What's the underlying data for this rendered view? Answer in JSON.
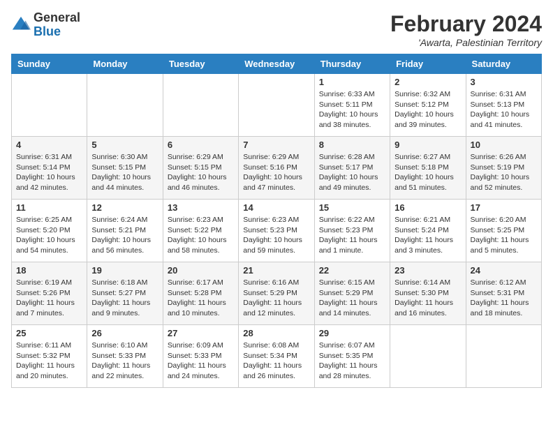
{
  "header": {
    "logo_general": "General",
    "logo_blue": "Blue",
    "month_title": "February 2024",
    "location": "'Awarta, Palestinian Territory"
  },
  "days_of_week": [
    "Sunday",
    "Monday",
    "Tuesday",
    "Wednesday",
    "Thursday",
    "Friday",
    "Saturday"
  ],
  "weeks": [
    [
      {
        "day": "",
        "detail": ""
      },
      {
        "day": "",
        "detail": ""
      },
      {
        "day": "",
        "detail": ""
      },
      {
        "day": "",
        "detail": ""
      },
      {
        "day": "1",
        "detail": "Sunrise: 6:33 AM\nSunset: 5:11 PM\nDaylight: 10 hours\nand 38 minutes."
      },
      {
        "day": "2",
        "detail": "Sunrise: 6:32 AM\nSunset: 5:12 PM\nDaylight: 10 hours\nand 39 minutes."
      },
      {
        "day": "3",
        "detail": "Sunrise: 6:31 AM\nSunset: 5:13 PM\nDaylight: 10 hours\nand 41 minutes."
      }
    ],
    [
      {
        "day": "4",
        "detail": "Sunrise: 6:31 AM\nSunset: 5:14 PM\nDaylight: 10 hours\nand 42 minutes."
      },
      {
        "day": "5",
        "detail": "Sunrise: 6:30 AM\nSunset: 5:15 PM\nDaylight: 10 hours\nand 44 minutes."
      },
      {
        "day": "6",
        "detail": "Sunrise: 6:29 AM\nSunset: 5:15 PM\nDaylight: 10 hours\nand 46 minutes."
      },
      {
        "day": "7",
        "detail": "Sunrise: 6:29 AM\nSunset: 5:16 PM\nDaylight: 10 hours\nand 47 minutes."
      },
      {
        "day": "8",
        "detail": "Sunrise: 6:28 AM\nSunset: 5:17 PM\nDaylight: 10 hours\nand 49 minutes."
      },
      {
        "day": "9",
        "detail": "Sunrise: 6:27 AM\nSunset: 5:18 PM\nDaylight: 10 hours\nand 51 minutes."
      },
      {
        "day": "10",
        "detail": "Sunrise: 6:26 AM\nSunset: 5:19 PM\nDaylight: 10 hours\nand 52 minutes."
      }
    ],
    [
      {
        "day": "11",
        "detail": "Sunrise: 6:25 AM\nSunset: 5:20 PM\nDaylight: 10 hours\nand 54 minutes."
      },
      {
        "day": "12",
        "detail": "Sunrise: 6:24 AM\nSunset: 5:21 PM\nDaylight: 10 hours\nand 56 minutes."
      },
      {
        "day": "13",
        "detail": "Sunrise: 6:23 AM\nSunset: 5:22 PM\nDaylight: 10 hours\nand 58 minutes."
      },
      {
        "day": "14",
        "detail": "Sunrise: 6:23 AM\nSunset: 5:23 PM\nDaylight: 10 hours\nand 59 minutes."
      },
      {
        "day": "15",
        "detail": "Sunrise: 6:22 AM\nSunset: 5:23 PM\nDaylight: 11 hours\nand 1 minute."
      },
      {
        "day": "16",
        "detail": "Sunrise: 6:21 AM\nSunset: 5:24 PM\nDaylight: 11 hours\nand 3 minutes."
      },
      {
        "day": "17",
        "detail": "Sunrise: 6:20 AM\nSunset: 5:25 PM\nDaylight: 11 hours\nand 5 minutes."
      }
    ],
    [
      {
        "day": "18",
        "detail": "Sunrise: 6:19 AM\nSunset: 5:26 PM\nDaylight: 11 hours\nand 7 minutes."
      },
      {
        "day": "19",
        "detail": "Sunrise: 6:18 AM\nSunset: 5:27 PM\nDaylight: 11 hours\nand 9 minutes."
      },
      {
        "day": "20",
        "detail": "Sunrise: 6:17 AM\nSunset: 5:28 PM\nDaylight: 11 hours\nand 10 minutes."
      },
      {
        "day": "21",
        "detail": "Sunrise: 6:16 AM\nSunset: 5:29 PM\nDaylight: 11 hours\nand 12 minutes."
      },
      {
        "day": "22",
        "detail": "Sunrise: 6:15 AM\nSunset: 5:29 PM\nDaylight: 11 hours\nand 14 minutes."
      },
      {
        "day": "23",
        "detail": "Sunrise: 6:14 AM\nSunset: 5:30 PM\nDaylight: 11 hours\nand 16 minutes."
      },
      {
        "day": "24",
        "detail": "Sunrise: 6:12 AM\nSunset: 5:31 PM\nDaylight: 11 hours\nand 18 minutes."
      }
    ],
    [
      {
        "day": "25",
        "detail": "Sunrise: 6:11 AM\nSunset: 5:32 PM\nDaylight: 11 hours\nand 20 minutes."
      },
      {
        "day": "26",
        "detail": "Sunrise: 6:10 AM\nSunset: 5:33 PM\nDaylight: 11 hours\nand 22 minutes."
      },
      {
        "day": "27",
        "detail": "Sunrise: 6:09 AM\nSunset: 5:33 PM\nDaylight: 11 hours\nand 24 minutes."
      },
      {
        "day": "28",
        "detail": "Sunrise: 6:08 AM\nSunset: 5:34 PM\nDaylight: 11 hours\nand 26 minutes."
      },
      {
        "day": "29",
        "detail": "Sunrise: 6:07 AM\nSunset: 5:35 PM\nDaylight: 11 hours\nand 28 minutes."
      },
      {
        "day": "",
        "detail": ""
      },
      {
        "day": "",
        "detail": ""
      }
    ]
  ]
}
